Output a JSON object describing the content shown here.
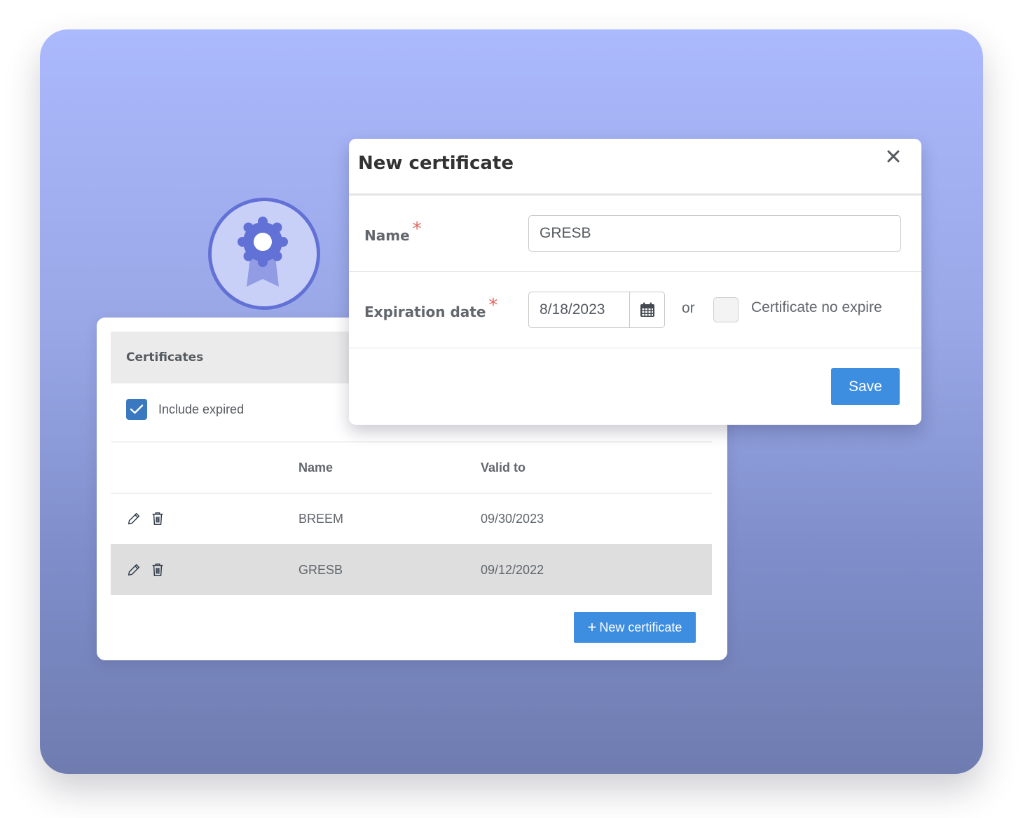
{
  "colors": {
    "accent": "#3d8de0",
    "checkbox": "#3a79bf",
    "required": "#e0675e",
    "badge_ring": "#6271d6",
    "badge_fill": "#c9d0f7"
  },
  "badge": {
    "icon": "award-ribbon-icon"
  },
  "certificates_panel": {
    "title": "Certificates",
    "include_expired": {
      "label": "Include expired",
      "checked": true
    },
    "columns": {
      "actions": "",
      "name": "Name",
      "valid_to": "Valid to"
    },
    "rows": [
      {
        "name": "BREEM",
        "valid_to": "09/30/2023",
        "icons": [
          "pencil-icon",
          "trash-icon"
        ]
      },
      {
        "name": "GRESB",
        "valid_to": "09/12/2022",
        "icons": [
          "pencil-icon",
          "trash-icon"
        ]
      }
    ],
    "new_button": {
      "plus": "+",
      "label": "New certificate"
    }
  },
  "modal": {
    "title": "New certificate",
    "close_icon": "close-icon",
    "name_field": {
      "label": "Name",
      "required_mark": "*",
      "value": "GRESB"
    },
    "expiration_field": {
      "label": "Expiration date",
      "required_mark": "*",
      "value": "8/18/2023",
      "calendar_icon": "calendar-icon"
    },
    "or_text": "or",
    "no_expire": {
      "label": "Certificate no expire",
      "checked": false
    },
    "save_label": "Save"
  }
}
